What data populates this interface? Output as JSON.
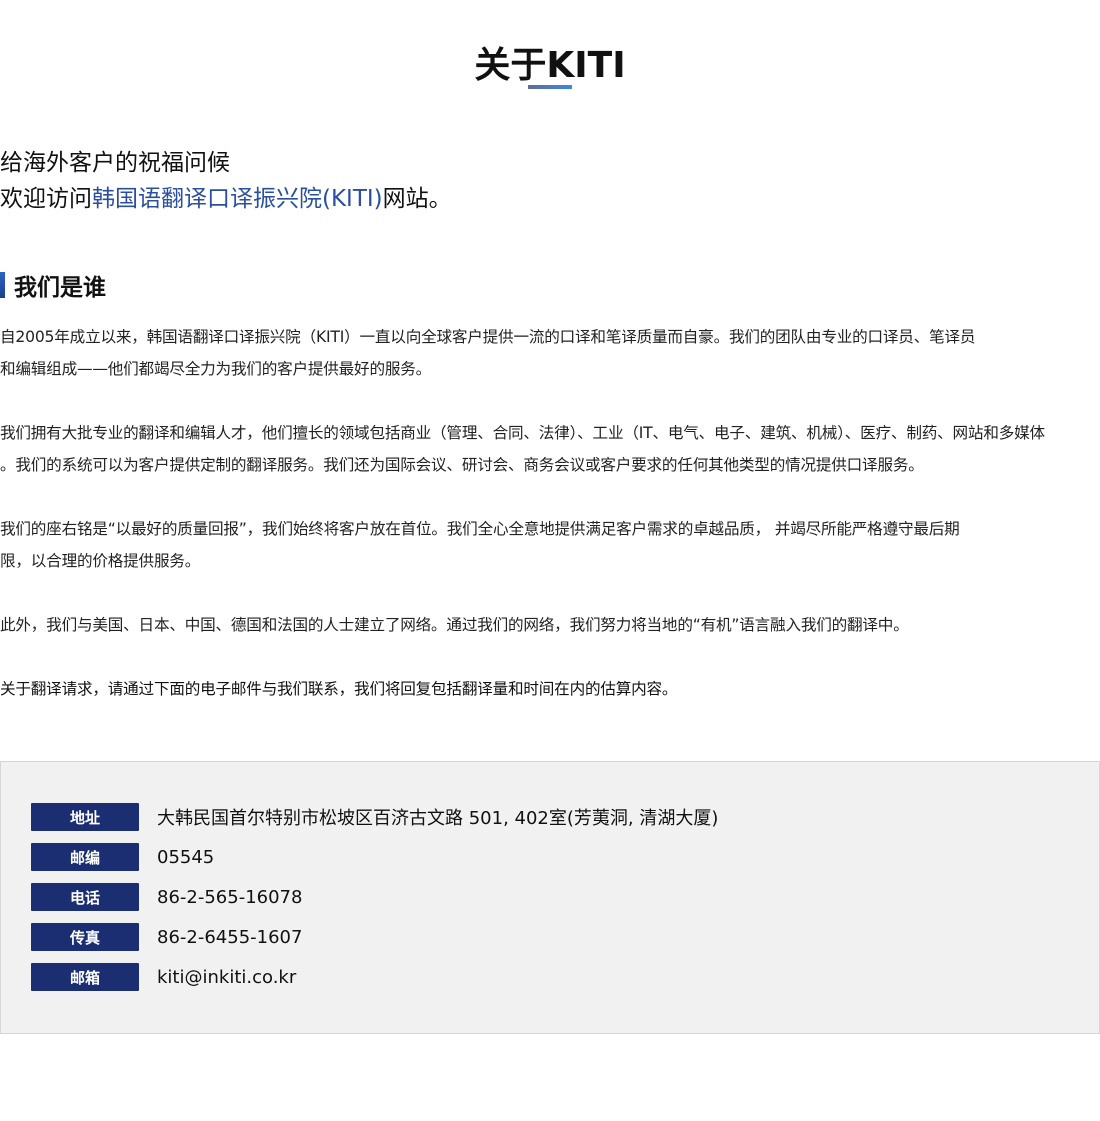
{
  "page": {
    "title": "关于KITI"
  },
  "greeting": {
    "line1": "给海外客户的祝福问候",
    "line2_prefix": "欢迎访问",
    "line2_highlight": "韩国语翻译口译振兴院(KITI)",
    "line2_suffix": "网站。"
  },
  "section": {
    "heading": "我们是谁"
  },
  "paragraphs": [
    {
      "lines": [
        "自2005年成立以来，韩国语翻译口译振兴院（KITI）一直以向全球客户提供一流的口译和笔译质量而自豪。我们的团队由专业的口译员、笔译员",
        "和编辑组成——他们都竭尽全力为我们的客户提供最好的服务。"
      ]
    },
    {
      "lines": [
        "我们拥有大批专业的翻译和编辑人才，他们擅长的领域包括商业（管理、合同、法律）、工业（IT、电气、电子、建筑、机械）、医疗、制药、网站和多媒体",
        "。我们的系统可以为客户提供定制的翻译服务。我们还为国际会议、研讨会、商务会议或客户要求的任何其他类型的情况提供口译服务。"
      ]
    },
    {
      "lines": [
        " 我们的座右铭是“以最好的质量回报”，我们始终将客户放在首位。我们全心全意地提供满足客户需求的卓越品质，  并竭尽所能严格遵守最后期",
        "限，以合理的价格提供服务。"
      ]
    },
    {
      "lines": [
        "此外，我们与美国、日本、中国、德国和法国的人士建立了网络。通过我们的网络，我们努力将当地的“有机”语言融入我们的翻译中。"
      ]
    },
    {
      "lines": [
        "关于翻译请求，请通过下面的电子邮件与我们联系，我们将回复包括翻译量和时间在内的估算内容。"
      ]
    }
  ],
  "contact": {
    "rows": [
      {
        "label": "地址",
        "value": "大韩民国首尔特别市松坡区百济古文路 501, 402室(芳荑洞, 清湖大厦)"
      },
      {
        "label": "邮编",
        "value": "05545"
      },
      {
        "label": "电话",
        "value": "86-2-565-16078"
      },
      {
        "label": "传真",
        "value": "86-2-6455-1607"
      },
      {
        "label": "邮箱",
        "value": "kiti@inkiti.co.kr"
      }
    ]
  },
  "colors": {
    "accent": "#2b4fa0",
    "label_bg": "#1c2e72",
    "box_bg": "#f1f1f1"
  }
}
